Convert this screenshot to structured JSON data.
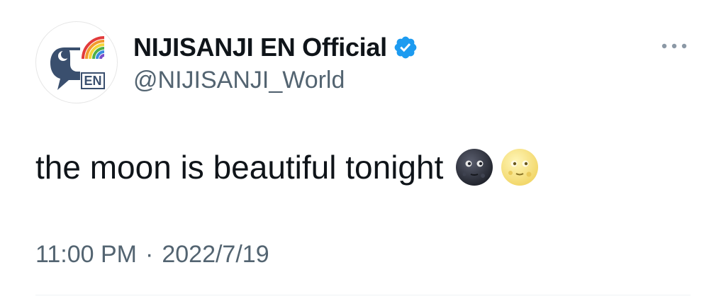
{
  "tweet": {
    "display_name": "NIJISANJI EN Official",
    "handle": "@NIJISANJI_World",
    "avatar_badge_text": "EN",
    "text": "the moon is beautiful tonight",
    "emojis": [
      "new-moon-face-icon",
      "full-moon-face-icon"
    ],
    "time": "11:00 PM",
    "separator": "·",
    "date": "2022/7/19",
    "verified": true
  },
  "colors": {
    "text_primary": "#0f1419",
    "text_secondary": "#536471",
    "verified_blue": "#1d9bf0",
    "divider": "#eff3f4"
  }
}
